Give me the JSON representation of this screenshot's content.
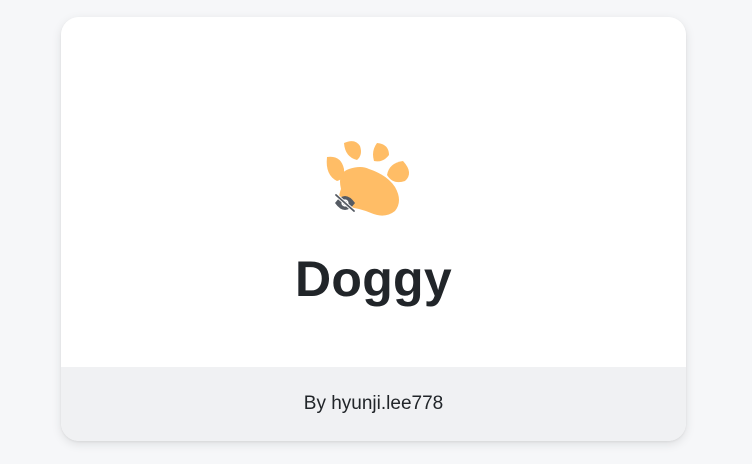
{
  "card": {
    "title": "Doggy",
    "author_line": "By hyunji.lee778"
  },
  "icons": {
    "main": "paw-icon",
    "visibility": "eye-slash-icon"
  },
  "colors": {
    "paw": "#ffbd66",
    "text": "#212529",
    "footer_bg": "#f0f1f3",
    "page_bg": "#f6f7f9",
    "visibility_icon": "#555b63"
  }
}
